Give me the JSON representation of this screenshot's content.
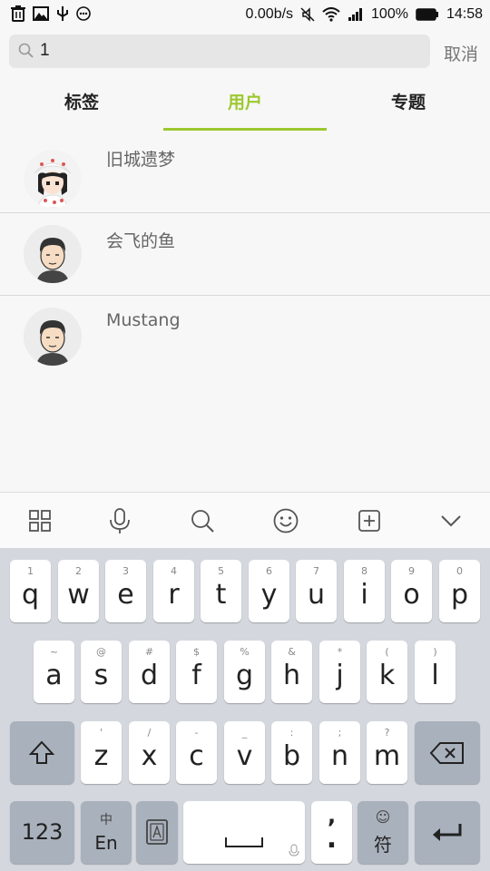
{
  "status_bar": {
    "net_speed": "0.00b/s",
    "battery": "100%",
    "time": "14:58"
  },
  "search": {
    "value": "1",
    "cancel_label": "取消"
  },
  "tabs": [
    {
      "label": "标签",
      "active": false
    },
    {
      "label": "用户",
      "active": true
    },
    {
      "label": "专题",
      "active": false
    }
  ],
  "users": [
    {
      "name": "旧城遗梦",
      "avatar": "girl-avatar"
    },
    {
      "name": "会飞的鱼",
      "avatar": "man-avatar"
    },
    {
      "name": "Mustang",
      "avatar": "man-avatar"
    }
  ],
  "keyboard": {
    "toolbar_icons": [
      "grid-icon",
      "microphone-icon",
      "search-icon",
      "emoji-icon",
      "plus-box-icon",
      "chevron-down-icon"
    ],
    "row1": [
      {
        "main": "q",
        "sub": "1"
      },
      {
        "main": "w",
        "sub": "2"
      },
      {
        "main": "e",
        "sub": "3"
      },
      {
        "main": "r",
        "sub": "4"
      },
      {
        "main": "t",
        "sub": "5"
      },
      {
        "main": "y",
        "sub": "6"
      },
      {
        "main": "u",
        "sub": "7"
      },
      {
        "main": "i",
        "sub": "8"
      },
      {
        "main": "o",
        "sub": "9"
      },
      {
        "main": "p",
        "sub": "0"
      }
    ],
    "row2": [
      {
        "main": "a",
        "sub": "~"
      },
      {
        "main": "s",
        "sub": "@"
      },
      {
        "main": "d",
        "sub": "#"
      },
      {
        "main": "f",
        "sub": "$"
      },
      {
        "main": "g",
        "sub": "%"
      },
      {
        "main": "h",
        "sub": "&"
      },
      {
        "main": "j",
        "sub": "*"
      },
      {
        "main": "k",
        "sub": "("
      },
      {
        "main": "l",
        "sub": ")"
      }
    ],
    "row3": [
      {
        "main": "z",
        "sub": "'"
      },
      {
        "main": "x",
        "sub": "/"
      },
      {
        "main": "c",
        "sub": "-"
      },
      {
        "main": "v",
        "sub": "_"
      },
      {
        "main": "b",
        "sub": ":"
      },
      {
        "main": "n",
        "sub": ";"
      },
      {
        "main": "m",
        "sub": "?"
      }
    ],
    "key_123": "123",
    "lang_top": "中",
    "lang_bottom": "En",
    "comma": ",",
    "period": ".",
    "symbol_top": "☺",
    "symbol_label": "符"
  }
}
